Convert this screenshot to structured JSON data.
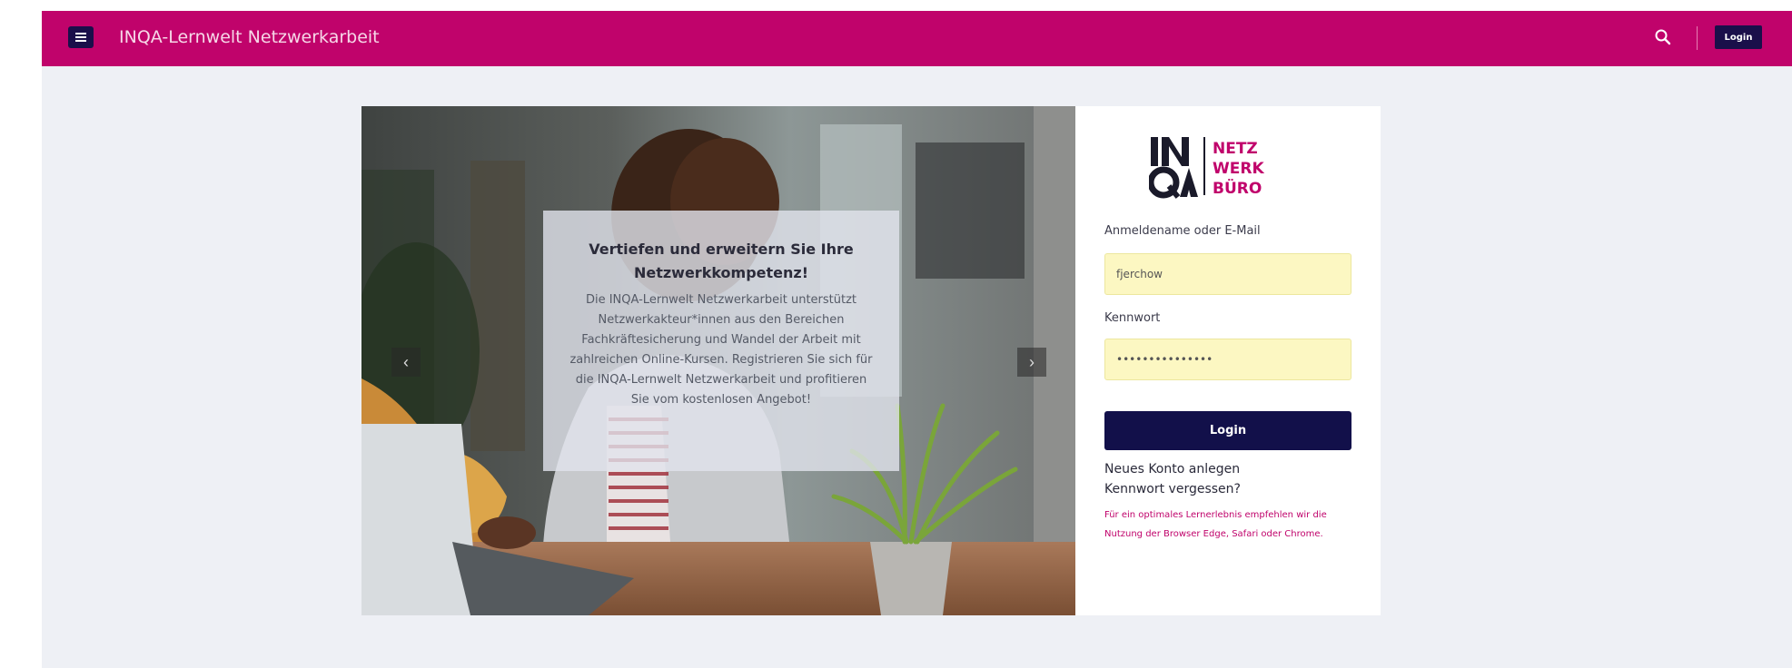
{
  "navbar": {
    "title": "INQA-Lernwelt Netzwerkarbeit",
    "menu_icon": "hamburger-icon",
    "search_icon": "search-icon",
    "login_label": "Login"
  },
  "carousel": {
    "heading": "Vertiefen und erweitern Sie Ihre Netzwerkkompetenz!",
    "text": "Die INQA-Lernwelt Netzwerkarbeit unterstützt Netzwerkakteur*innen aus den Bereichen Fachkräftesicherung und Wandel der Arbeit mit zahlreichen Online-Kursen. Registrieren Sie sich für die INQA-Lernwelt Netzwerkarbeit und profitieren Sie vom kostenlosen Angebot!",
    "prev_icon": "chevron-left-icon",
    "next_icon": "chevron-right-icon"
  },
  "login": {
    "logo": {
      "line1": "NETZ",
      "line2": "WERK",
      "line3": "BÜRO",
      "mark": "INQA"
    },
    "username_label": "Anmeldename oder E-Mail",
    "username_value": "fjerchow",
    "password_label": "Kennwort",
    "password_value": "•••••••••••••••",
    "submit_label": "Login",
    "new_account": "Neues Konto anlegen",
    "forgot_password": "Kennwort vergessen?",
    "browser_note": "Für ein optimales Lernerlebnis empfehlen wir die Nutzung der Browser Edge, Safari oder Chrome."
  },
  "colors": {
    "brand": "#c0036b",
    "navy": "#12104a",
    "input_bg": "#fcf7c2",
    "page_bg": "#eef0f5"
  }
}
